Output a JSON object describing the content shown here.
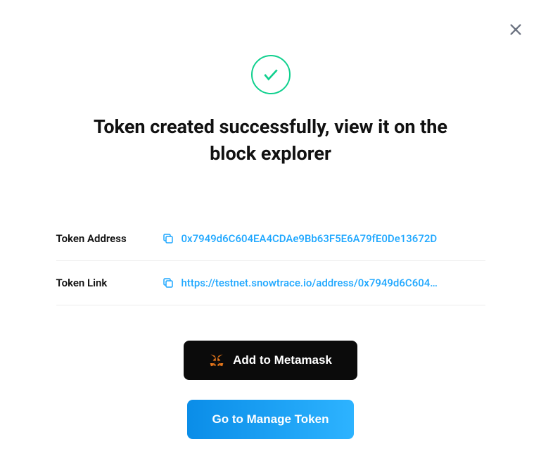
{
  "title": "Token created successfully, view it on the block explorer",
  "rows": {
    "address": {
      "label": "Token Address",
      "value": "0x7949d6C604EA4CDAe9Bb63F5E6A79fE0De13672D"
    },
    "link": {
      "label": "Token Link",
      "value": "https://testnet.snowtrace.io/address/0x7949d6C604…"
    }
  },
  "buttons": {
    "metamask": "Add to Metamask",
    "manage": "Go to Manage Token"
  }
}
